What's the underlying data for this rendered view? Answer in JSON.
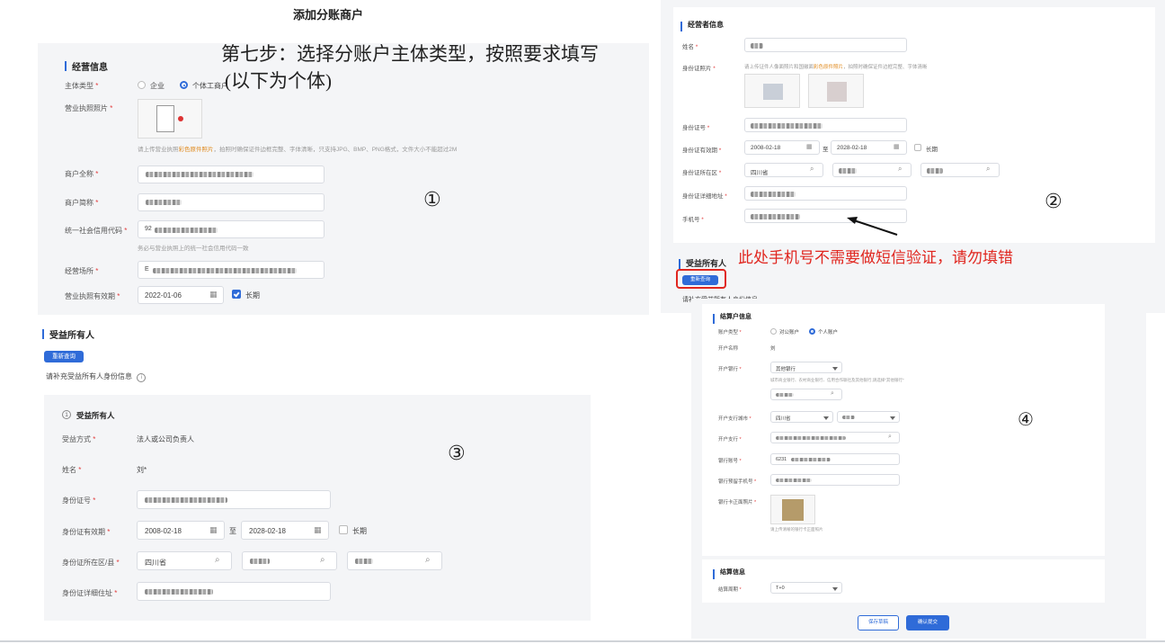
{
  "page": {
    "title": "添加分账商户"
  },
  "step_note": {
    "line1": "第七步：选择分账户主体类型，按照要求填写",
    "line2": "(以下为个体)"
  },
  "warning": "此处手机号不需要做短信验证，请勿填错",
  "markers": [
    "①",
    "②",
    "③",
    "④"
  ],
  "panel1": {
    "title": "经营信息",
    "subject_type_label": "主体类型",
    "subject_options": [
      "企业",
      "个体工商户"
    ],
    "license_photo_label": "营业执照照片",
    "license_hint_pre": "请上传营业执照",
    "license_hint_colored": "彩色原件照片",
    "license_hint_post": "，拍照时确保证件边框完整、字体清晰，只支持JPG、BMP、PNG格式，文件大小不能超过2M",
    "full_name_label": "商户全称",
    "short_name_label": "商户简称",
    "credit_code_label": "统一社会信用代码",
    "credit_code_value_prefix": "92",
    "credit_code_hint": "务必与营业执照上的统一社会信用代码一致",
    "place_label": "经营场所",
    "place_value_prefix": "E",
    "validity_label": "营业执照有效期",
    "validity_start": "2022-01-06",
    "long_term_label": "长期"
  },
  "panel2": {
    "title": "经营者信息",
    "name_label": "姓名",
    "id_photo_label": "身份证照片",
    "id_photo_hint_pre": "请上传证件人像面照片和国徽面",
    "id_photo_hint_colored": "彩色原件照片",
    "id_photo_hint_post": "，拍照时确保证件边框完整、字体清晰",
    "id_no_label": "身份证号",
    "id_validity_label": "身份证有效期",
    "id_start": "2008-02-18",
    "to": "至",
    "id_end": "2028-02-18",
    "long_term_label": "长期",
    "region_label": "身份证所在区",
    "province": "四川省",
    "address_label": "身份证详细地址",
    "phone_label": "手机号",
    "beneficiary_title": "受益所有人",
    "requery_label": "重新查询",
    "fill_hint": "请补充受益所有人身份信息"
  },
  "panel3": {
    "title": "受益所有人",
    "requery_label": "重新查询",
    "fill_hint": "请补充受益所有人身份信息",
    "card_index": "1",
    "card_title": "受益所有人",
    "method_label": "受益方式",
    "method_value": "法人或公司负责人",
    "name_label": "姓名",
    "name_value": "刘*",
    "id_no_label": "身份证号",
    "id_validity_label": "身份证有效期",
    "id_start": "2008-02-18",
    "to": "至",
    "id_end": "2028-02-18",
    "long_term_label": "长期",
    "region_label": "身份证所在区/县",
    "province": "四川省",
    "address_label": "身份证详细住址"
  },
  "panel4": {
    "title": "结算户信息",
    "account_type_label": "账户类型",
    "account_options": [
      "对公账户",
      "个人账户"
    ],
    "account_name_label": "开户名称",
    "account_name_value": "刘",
    "bank_label": "开户银行",
    "bank_value": "其他银行",
    "bank_hint": "城市商业银行、农村商业银行、信用合作联社及其他银行,请选择\"其他银行\"",
    "bank_city_label": "开户支行城市",
    "bank_city_value": "四川省",
    "branch_label": "开户支行",
    "card_no_label": "银行账号",
    "card_no_prefix": "6231",
    "bank_phone_label": "银行预留手机号",
    "card_photo_label": "银行卡正面照片",
    "card_photo_hint": "请上传清晰的银行卡正面照片",
    "settle_title": "结算信息",
    "settle_cycle_label": "结算周期",
    "settle_cycle_value": "T+0",
    "save_draft": "保存草稿",
    "submit": "确认提交"
  },
  "colors": {
    "accent": "#2f6bd8",
    "warning": "#e0261f",
    "required": "#e23b3b"
  }
}
